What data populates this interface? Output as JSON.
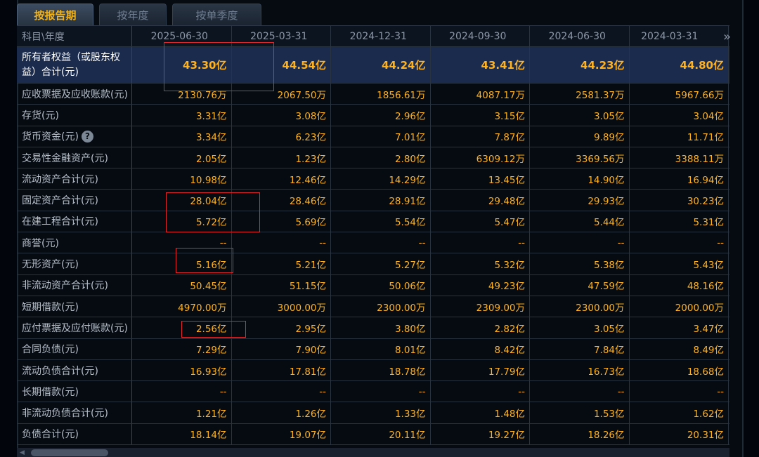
{
  "tabs": [
    {
      "label": "按报告期",
      "active": true
    },
    {
      "label": "按年度",
      "active": false
    },
    {
      "label": "按单季度",
      "active": false
    }
  ],
  "header": {
    "corner": "科目\\年度",
    "periods": [
      "2025-06-30",
      "2025-03-31",
      "2024-12-31",
      "2024-09-30",
      "2024-06-30",
      "2024-03-31"
    ],
    "more": "»"
  },
  "rows": [
    {
      "label": "所有者权益（或股东权益）合计(元)",
      "values": [
        "43.30亿",
        "44.54亿",
        "44.24亿",
        "43.41亿",
        "44.23亿",
        "44.80亿"
      ]
    },
    {
      "label": "应收票据及应收账款(元)",
      "values": [
        "2130.76万",
        "2067.50万",
        "1856.61万",
        "4087.17万",
        "2581.37万",
        "5967.66万"
      ]
    },
    {
      "label": "存货(元)",
      "values": [
        "3.31亿",
        "3.08亿",
        "2.96亿",
        "3.15亿",
        "3.05亿",
        "3.04亿"
      ]
    },
    {
      "label": "货币资金(元)",
      "values": [
        "3.34亿",
        "6.23亿",
        "7.01亿",
        "7.87亿",
        "9.89亿",
        "11.71亿"
      ],
      "help": "?"
    },
    {
      "label": "交易性金融资产(元)",
      "values": [
        "2.05亿",
        "1.23亿",
        "2.80亿",
        "6309.12万",
        "3369.56万",
        "3388.11万"
      ]
    },
    {
      "label": "流动资产合计(元)",
      "values": [
        "10.98亿",
        "12.46亿",
        "14.29亿",
        "13.45亿",
        "14.90亿",
        "16.94亿"
      ]
    },
    {
      "label": "固定资产合计(元)",
      "values": [
        "28.04亿",
        "28.46亿",
        "28.91亿",
        "29.48亿",
        "29.93亿",
        "30.23亿"
      ]
    },
    {
      "label": "在建工程合计(元)",
      "values": [
        "5.72亿",
        "5.69亿",
        "5.54亿",
        "5.47亿",
        "5.44亿",
        "5.31亿"
      ]
    },
    {
      "label": "商誉(元)",
      "values": [
        "--",
        "--",
        "--",
        "--",
        "--",
        "--"
      ]
    },
    {
      "label": "无形资产(元)",
      "values": [
        "5.16亿",
        "5.21亿",
        "5.27亿",
        "5.32亿",
        "5.38亿",
        "5.43亿"
      ]
    },
    {
      "label": "非流动资产合计(元)",
      "values": [
        "50.45亿",
        "51.15亿",
        "50.06亿",
        "49.23亿",
        "47.59亿",
        "48.16亿"
      ]
    },
    {
      "label": "短期借款(元)",
      "values": [
        "4970.00万",
        "3000.00万",
        "2300.00万",
        "2309.00万",
        "2300.00万",
        "2000.00万"
      ]
    },
    {
      "label": "应付票据及应付账款(元)",
      "values": [
        "2.56亿",
        "2.95亿",
        "3.80亿",
        "2.82亿",
        "3.05亿",
        "3.47亿"
      ]
    },
    {
      "label": "合同负债(元)",
      "values": [
        "7.29亿",
        "7.90亿",
        "8.01亿",
        "8.42亿",
        "7.84亿",
        "8.49亿"
      ]
    },
    {
      "label": "流动负债合计(元)",
      "values": [
        "16.93亿",
        "17.81亿",
        "18.78亿",
        "17.79亿",
        "16.73亿",
        "18.68亿"
      ]
    },
    {
      "label": "长期借款(元)",
      "values": [
        "--",
        "--",
        "--",
        "--",
        "--",
        "--"
      ]
    },
    {
      "label": "非流动负债合计(元)",
      "values": [
        "1.21亿",
        "1.26亿",
        "1.33亿",
        "1.48亿",
        "1.53亿",
        "1.62亿"
      ]
    },
    {
      "label": "负债合计(元)",
      "values": [
        "18.14亿",
        "19.07亿",
        "20.11亿",
        "19.27亿",
        "18.26亿",
        "20.31亿"
      ]
    }
  ],
  "colors": {
    "value": "#ffb21d",
    "highlight_row": "#1b2b4d",
    "annotation_box": "#e3262a"
  }
}
